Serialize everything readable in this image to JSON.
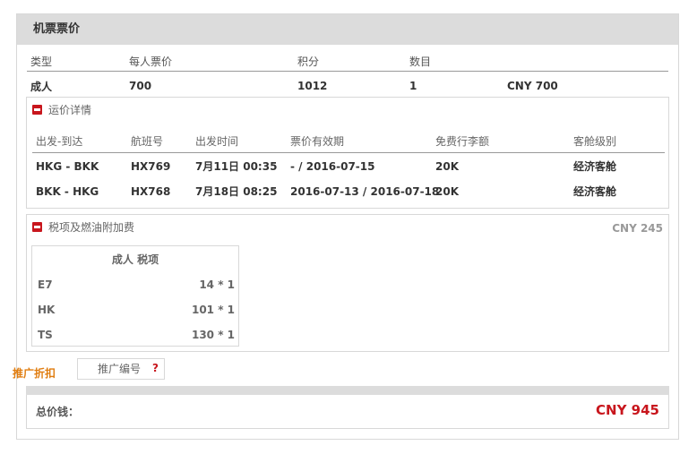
{
  "panel": {
    "title": "机票票价"
  },
  "summary": {
    "headers": [
      "类型",
      "每人票价",
      "积分",
      "数目"
    ],
    "row": {
      "type": "成人",
      "price": "700",
      "points": "1012",
      "count": "1",
      "total": "CNY 700"
    }
  },
  "fare_details": {
    "title": "运价详情",
    "headers": [
      "出发-到达",
      "航班号",
      "出发时间",
      "票价有效期",
      "免费行李额",
      "客舱级别"
    ],
    "rows": [
      {
        "route": "HKG - BKK",
        "flight": "HX769",
        "departure": "7月11日 00:35",
        "validity": "- / 2016-07-15",
        "baggage": "20K",
        "cabin": "经济客舱"
      },
      {
        "route": "BKK - HKG",
        "flight": "HX768",
        "departure": "7月18日 08:25",
        "validity": "2016-07-13 / 2016-07-18",
        "baggage": "20K",
        "cabin": "经济客舱"
      }
    ]
  },
  "taxes": {
    "title": "税项及燃油附加费",
    "amount": "CNY 245",
    "inner_title": "成人 税项",
    "items": [
      {
        "code": "E7",
        "amount": "14 * 1"
      },
      {
        "code": "HK",
        "amount": "101 * 1"
      },
      {
        "code": "TS",
        "amount": "130 * 1"
      }
    ]
  },
  "promo": {
    "label": "推广折扣",
    "placeholder": "推广编号",
    "help": "?"
  },
  "total": {
    "label": "总价钱：",
    "value": "CNY 945"
  },
  "colors": {
    "accent_red": "#c8161d",
    "promo_orange": "#e07d10",
    "header_gray": "#dcdcdc"
  }
}
